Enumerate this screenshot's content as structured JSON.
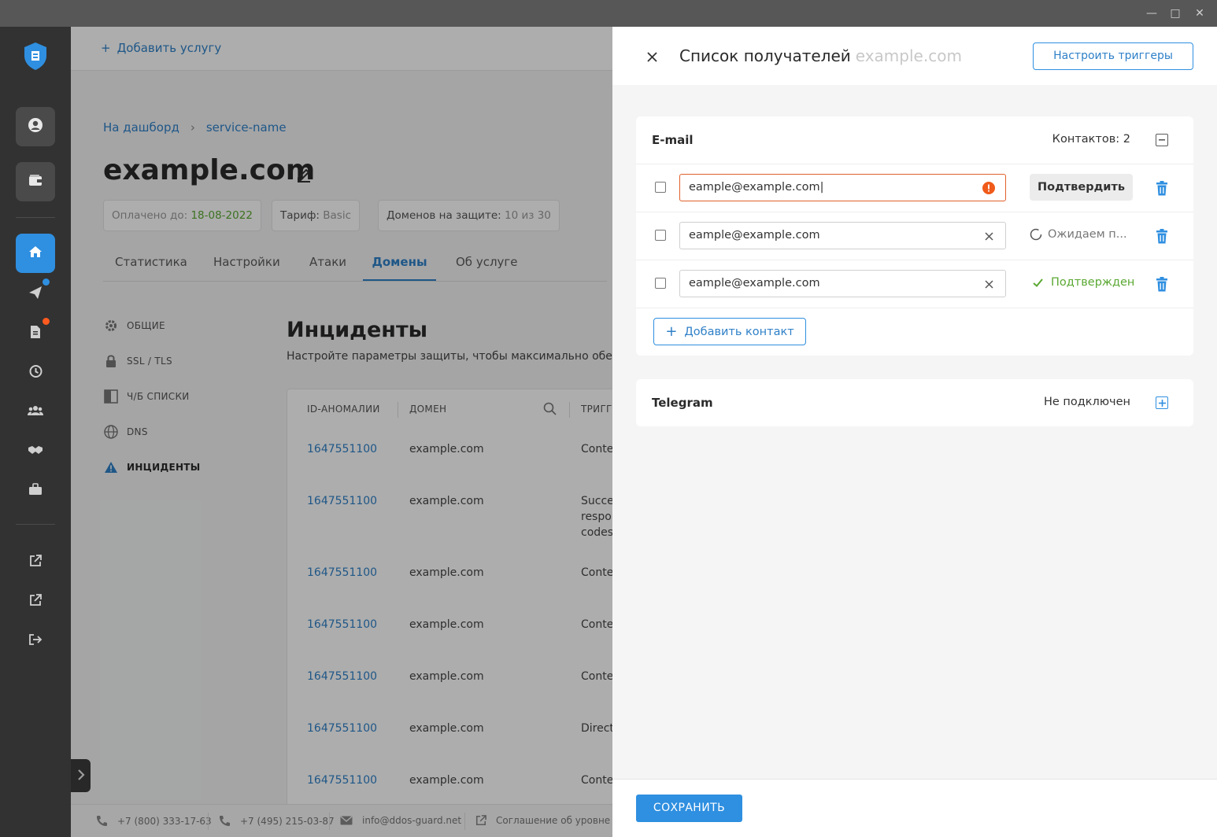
{
  "topbar": {
    "add_service_label": "Добавить услугу"
  },
  "breadcrumb": {
    "home": "На дашборд",
    "current": "service-name"
  },
  "page": {
    "title": "example.com"
  },
  "info": {
    "paid_label": "Оплачено до:",
    "paid_value": "18-08-2022",
    "tariff_label": "Тариф:",
    "tariff_value": "Basic",
    "domains_label": "Доменов на защите:",
    "domains_value": "10 из 30"
  },
  "tabs": [
    "Статистика",
    "Настройки",
    "Атаки",
    "Домены",
    "Об услуге"
  ],
  "active_tab": "Домены",
  "subnav": [
    "ОБЩИЕ",
    "SSL / TLS",
    "Ч/Б СПИСКИ",
    "DNS",
    "ИНЦИДЕНТЫ"
  ],
  "section": {
    "title": "Инциденты",
    "desc": "Настройте параметры защиты, чтобы максимально обез"
  },
  "table": {
    "headers": [
      "ID-АНОМАЛИИ",
      "ДОМЕН",
      "ТРИГГ"
    ],
    "rows": [
      {
        "id": "1647551100",
        "domain": "example.com",
        "trigger": "Conte"
      },
      {
        "id": "1647551100",
        "domain": "example.com",
        "trigger": "Succe\nrespo\ncodes"
      },
      {
        "id": "1647551100",
        "domain": "example.com",
        "trigger": "Conte"
      },
      {
        "id": "1647551100",
        "domain": "example.com",
        "trigger": "Conte"
      },
      {
        "id": "1647551100",
        "domain": "example.com",
        "trigger": "Conte"
      },
      {
        "id": "1647551100",
        "domain": "example.com",
        "trigger": "Direct"
      },
      {
        "id": "1647551100",
        "domain": "example.com",
        "trigger": "Conte"
      }
    ]
  },
  "footer": {
    "phone1": "+7 (800) 333-17-63",
    "phone2": "+7 (495) 215-03-87",
    "email": "info@ddos-guard.net",
    "sla": "Соглашение об уровне ус"
  },
  "panel": {
    "title": "Список получателей",
    "title_domain": "example.com",
    "triggers_button": "Настроить триггеры",
    "email_card": {
      "title": "E-mail",
      "contacts_count": "Контактов: 2",
      "contacts": [
        {
          "value": "eample@example.com",
          "state": "error",
          "action": "Подтвердить"
        },
        {
          "value": "eample@example.com",
          "state": "pending",
          "status": "Ожидаем п..."
        },
        {
          "value": "eample@example.com",
          "state": "confirmed",
          "status": "Подтвержден"
        }
      ],
      "add_contact": "Добавить контакт"
    },
    "telegram_card": {
      "title": "Telegram",
      "status": "Не подключен"
    },
    "save_button": "СОХРАНИТЬ"
  },
  "colors": {
    "accent": "#2f8fe0",
    "error": "#e0602a",
    "success": "#5aa832"
  }
}
